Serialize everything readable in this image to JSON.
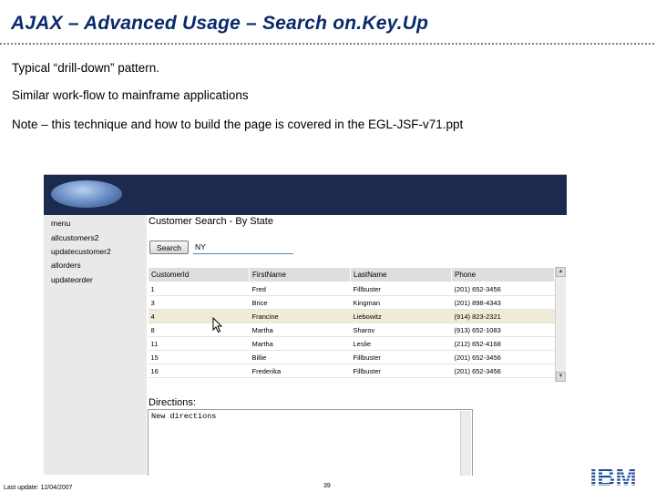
{
  "slide": {
    "title": "AJAX – Advanced Usage – Search on.Key.Up",
    "bullets": [
      "Typical “drill-down” pattern.",
      "Similar work-flow to mainframe applications",
      "Note – this technique and how to build the page is covered in the EGL-JSF-v71.ppt"
    ],
    "footer": {
      "last_update": "Last update: 12/04/2007",
      "page_number": "39"
    },
    "logo_text": "IBM"
  },
  "app": {
    "nav": [
      "menu",
      "allcustomers2",
      "updatecustomer2",
      "allorders",
      "updateorder"
    ],
    "heading": "Customer Search - By State",
    "search_button": "Search",
    "search_value": "NY",
    "table": {
      "columns": [
        "CustomerId",
        "FirstName",
        "LastName",
        "Phone"
      ],
      "rows": [
        [
          "1",
          "Fred",
          "Fillbuster",
          "(201) 652-3456"
        ],
        [
          "3",
          "Brice",
          "Kingman",
          "(201) 898-4343"
        ],
        [
          "4",
          "Francine",
          "Liebowitz",
          "(914) 823-2321"
        ],
        [
          "8",
          "Martha",
          "Sharov",
          "(913) 652-1083"
        ],
        [
          "11",
          "Martha",
          "Leslie",
          "(212) 652-4168"
        ],
        [
          "15",
          "Billie",
          "Fillbuster",
          "(201) 652-3456"
        ],
        [
          "16",
          "Frederika",
          "Fillbuster",
          "(201) 652-3456"
        ]
      ],
      "selected_row": 2
    },
    "directions_label": "Directions:",
    "directions_value": "New directions"
  },
  "colors": {
    "title": "#0b2a6b",
    "app_header": "#1b2a4d",
    "selected_row": "#f0ebd6",
    "ibm_blue": "#1f4f9a"
  },
  "icons": {
    "cursor": "mouse-pointer-icon",
    "logo": "ibm-logo"
  }
}
